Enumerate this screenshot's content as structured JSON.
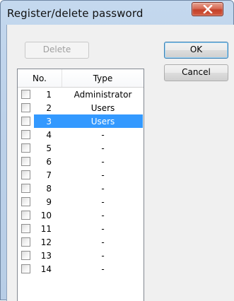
{
  "window": {
    "title": "Register/delete password"
  },
  "buttons": {
    "delete_label": "Delete",
    "ok_label": "OK",
    "cancel_label": "Cancel"
  },
  "list": {
    "headers": {
      "no": "No.",
      "type": "Type"
    },
    "rows": [
      {
        "no": "1",
        "type": "Administrator",
        "checked": false,
        "selected": false
      },
      {
        "no": "2",
        "type": "Users",
        "checked": false,
        "selected": false
      },
      {
        "no": "3",
        "type": "Users",
        "checked": false,
        "selected": true
      },
      {
        "no": "4",
        "type": "-",
        "checked": false,
        "selected": false
      },
      {
        "no": "5",
        "type": "-",
        "checked": false,
        "selected": false
      },
      {
        "no": "6",
        "type": "-",
        "checked": false,
        "selected": false
      },
      {
        "no": "7",
        "type": "-",
        "checked": false,
        "selected": false
      },
      {
        "no": "8",
        "type": "-",
        "checked": false,
        "selected": false
      },
      {
        "no": "9",
        "type": "-",
        "checked": false,
        "selected": false
      },
      {
        "no": "10",
        "type": "-",
        "checked": false,
        "selected": false
      },
      {
        "no": "11",
        "type": "-",
        "checked": false,
        "selected": false
      },
      {
        "no": "12",
        "type": "-",
        "checked": false,
        "selected": false
      },
      {
        "no": "13",
        "type": "-",
        "checked": false,
        "selected": false
      },
      {
        "no": "14",
        "type": "-",
        "checked": false,
        "selected": false
      }
    ]
  },
  "colors": {
    "selection": "#3399ff",
    "close_button": "#c4412a"
  },
  "icons": {
    "close": "close-icon"
  }
}
